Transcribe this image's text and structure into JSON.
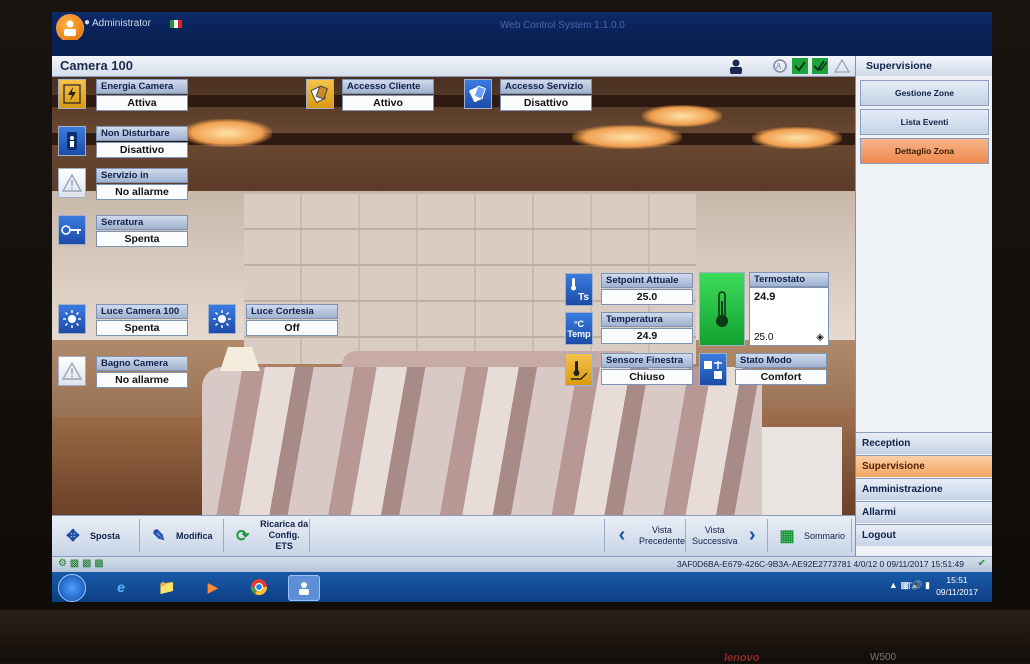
{
  "window": {
    "user": "Administrator",
    "app_title": "Web Control System 1.1.0.0"
  },
  "header": {
    "title": "Camera 100"
  },
  "widgets": {
    "energia": {
      "label": "Energia Camera",
      "value": "Attiva",
      "icon": "lightning-icon"
    },
    "accesso_cliente": {
      "label": "Accesso Cliente",
      "value": "Attivo",
      "icon": "keycard-icon"
    },
    "accesso_servizio": {
      "label": "Accesso Servizio",
      "value": "Disattivo",
      "icon": "keycard-icon"
    },
    "non_disturbare": {
      "label": "Non Disturbare",
      "value": "Disattivo",
      "icon": "do-not-disturb-icon"
    },
    "servizio": {
      "label": "Servizio in",
      "value": "No allarme",
      "icon": "warning-icon"
    },
    "serratura": {
      "label": "Serratura",
      "value": "Spenta",
      "icon": "key-icon"
    },
    "luce_camera": {
      "label": "Luce Camera 100",
      "value": "Spenta",
      "icon": "bulb-icon"
    },
    "luce_cortesia": {
      "label": "Luce Cortesia",
      "value": "Off",
      "icon": "bulb-icon"
    },
    "bagno": {
      "label": "Bagno Camera",
      "value": "No allarme",
      "icon": "warning-icon"
    },
    "setpoint": {
      "label": "Setpoint Attuale",
      "value": "25.0",
      "icon_text": "Ts"
    },
    "temperatura": {
      "label": "Temperatura",
      "value": "24.9",
      "icon_text": "°C Temp"
    },
    "sensore": {
      "label": "Sensore Finestra",
      "value": "Chiuso",
      "icon": "window-sensor-icon"
    },
    "termostato": {
      "label": "Termostato",
      "value": "24.9",
      "setpoint": "25.0",
      "icon": "thermometer-icon"
    },
    "stato_modo": {
      "label": "Stato Modo",
      "value": "Comfort",
      "icon": "mode-icon"
    }
  },
  "right_panel": {
    "title": "Supervisione",
    "buttons": [
      "Gestione Zone",
      "Lista Eventi",
      "Dettaglio Zona"
    ],
    "selected_button": "Dettaglio Zona",
    "nav": [
      "Reception",
      "Supervisione",
      "Amministrazione",
      "Allarmi",
      "Logout"
    ],
    "selected_nav": "Supervisione"
  },
  "toolbar": {
    "sposta": "Sposta",
    "modifica": "Modifica",
    "ricarica_1": "Ricarica da",
    "ricarica_2": "Config. ETS",
    "vista_prec_1": "Vista",
    "vista_prec_2": "Precedente",
    "vista_succ_1": "Vista",
    "vista_succ_2": "Successiva",
    "sommario": "Sommario"
  },
  "status": {
    "text": "3AF0D6BA-E679-426C-9B3A-AE92E2773781 4/0/12 0 09/11/2017 15:51:49"
  },
  "taskbar": {
    "lang": "IT",
    "time": "15:51",
    "date": "09/11/2017"
  },
  "laptop": {
    "brand": "lenovo",
    "model": "W500"
  },
  "colors": {
    "accent_orange": "#ef8a4e",
    "widget_blue": "#1c4ca8",
    "thermostat_green": "#13a030"
  }
}
